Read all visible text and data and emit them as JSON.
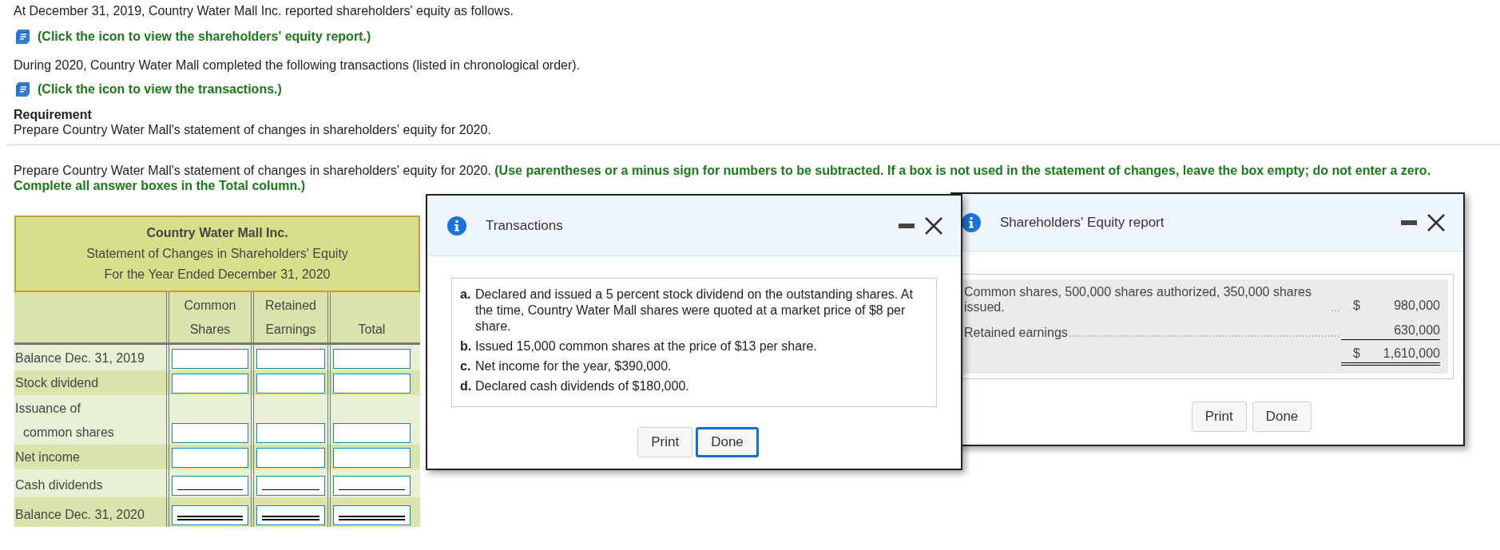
{
  "intro": {
    "text": "At December 31, 2019, Country Water Mall Inc. reported shareholders' equity as follows.",
    "link": "(Click the icon to view the shareholders' equity report.)"
  },
  "transactions_intro": {
    "text": "During 2020, Country Water Mall completed the following transactions (listed in chronological order).",
    "link": "(Click the icon to view the transactions.)"
  },
  "requirement": {
    "heading": "Requirement",
    "text": "Prepare Country Water Mall's statement of changes in shareholders' equity for 2020."
  },
  "instructions": {
    "text": "Prepare Country Water Mall's statement of changes in shareholders' equity for 2020.",
    "note": "(Use parentheses or a minus sign for numbers to be subtracted. If a box is not used in the statement of changes, leave the box empty; do not enter a zero. Complete all answer boxes in the Total column.)"
  },
  "statement": {
    "company": "Country Water Mall Inc.",
    "title": "Statement of Changes in Shareholders' Equity",
    "period": "For the Year Ended December 31, 2020",
    "columns": [
      {
        "line1": "Common",
        "line2": "Shares"
      },
      {
        "line1": "Retained",
        "line2": "Earnings"
      },
      {
        "line2": "Total"
      }
    ],
    "rows": [
      {
        "label": "Balance Dec. 31, 2019",
        "kind": "plain"
      },
      {
        "label": "Stock dividend",
        "kind": "plain"
      },
      {
        "label": "Issuance of",
        "label_continued": "common shares",
        "kind": "plain"
      },
      {
        "label": "Net income",
        "kind": "plain"
      },
      {
        "label": "Cash dividends",
        "kind": "single_rule"
      },
      {
        "label": "Balance Dec. 31, 2020",
        "kind": "double_rule"
      }
    ]
  },
  "equity_dialog": {
    "title": "Shareholders' Equity report",
    "lines": [
      {
        "label": "Common shares, 500,000 shares authorized, 350,000 shares issued.",
        "currency": "$",
        "amount": "980,000",
        "kind": "item"
      },
      {
        "label": "Retained earnings",
        "amount": "630,000",
        "kind": "subtotal"
      },
      {
        "currency": "$",
        "amount": "1,610,000",
        "kind": "total"
      }
    ],
    "buttons": [
      {
        "label": "Print",
        "focused": false
      },
      {
        "label": "Done",
        "focused": false
      }
    ]
  },
  "transactions_dialog": {
    "title": "Transactions",
    "items": [
      {
        "marker": "a.",
        "text": "Declared and issued a 5 percent stock dividend on the outstanding shares. At the time, Country Water Mall shares were quoted at a market price of $8 per share."
      },
      {
        "marker": "b.",
        "text": "Issued 15,000 common shares at the price of $13 per share."
      },
      {
        "marker": "c.",
        "text": "Net income for the year, $390,000."
      },
      {
        "marker": "d.",
        "text": "Declared cash dividends of $180,000."
      }
    ],
    "buttons": [
      {
        "label": "Print",
        "focused": false
      },
      {
        "label": "Done",
        "focused": true
      }
    ]
  }
}
